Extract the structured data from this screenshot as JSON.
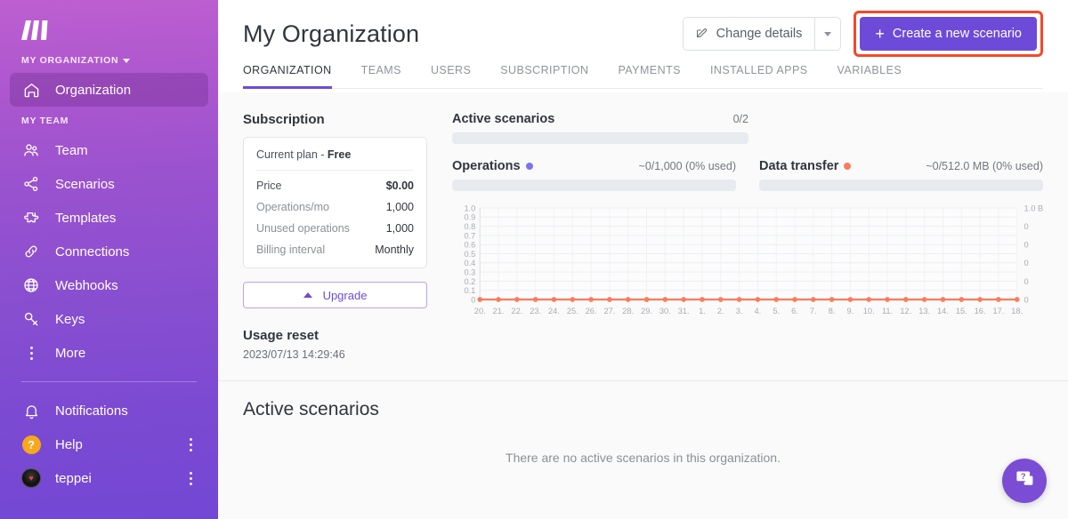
{
  "sidebar": {
    "logo_name": "make-logo",
    "org_group_label": "MY ORGANIZATION",
    "team_group_label": "MY TEAM",
    "org_items": [
      {
        "label": "Organization",
        "icon": "home-icon",
        "active": true
      }
    ],
    "team_items": [
      {
        "label": "Team",
        "icon": "team-icon"
      },
      {
        "label": "Scenarios",
        "icon": "scenarios-icon"
      },
      {
        "label": "Templates",
        "icon": "templates-icon"
      },
      {
        "label": "Connections",
        "icon": "connections-icon"
      },
      {
        "label": "Webhooks",
        "icon": "webhooks-icon"
      },
      {
        "label": "Keys",
        "icon": "keys-icon"
      },
      {
        "label": "More",
        "icon": "more-icon"
      }
    ],
    "bottom_items": [
      {
        "label": "Notifications",
        "icon": "bell-icon"
      },
      {
        "label": "Help",
        "icon": "help-icon"
      },
      {
        "label": "teppei",
        "icon": "avatar-icon"
      }
    ]
  },
  "header": {
    "title": "My Organization",
    "change_details_label": "Change details",
    "change_details_icon": "edit-icon",
    "create_scenario_label": "Create a new scenario",
    "highlight_color": "#f4472b",
    "primary_color": "#6d4bd8"
  },
  "tabs": [
    {
      "label": "ORGANIZATION",
      "active": true
    },
    {
      "label": "TEAMS",
      "active": false
    },
    {
      "label": "USERS",
      "active": false
    },
    {
      "label": "SUBSCRIPTION",
      "active": false
    },
    {
      "label": "PAYMENTS",
      "active": false
    },
    {
      "label": "INSTALLED APPS",
      "active": false
    },
    {
      "label": "VARIABLES",
      "active": false
    }
  ],
  "subscription": {
    "section_title": "Subscription",
    "current_plan_prefix": "Current plan - ",
    "current_plan_name": "Free",
    "rows": [
      {
        "key": "Price",
        "value": "$0.00"
      },
      {
        "key": "Operations/mo",
        "value": "1,000"
      },
      {
        "key": "Unused operations",
        "value": "1,000"
      },
      {
        "key": "Billing interval",
        "value": "Monthly"
      }
    ],
    "upgrade_label": "Upgrade",
    "usage_reset_title": "Usage reset",
    "usage_reset_value": "2023/07/13 14:29:46"
  },
  "meters": {
    "active_scenarios": {
      "name": "Active scenarios",
      "value": "0/2",
      "progress_pct": 0
    },
    "operations": {
      "name": "Operations",
      "value": "~0/1,000 (0% used)",
      "dot_color": "#7b74f0",
      "progress_pct": 0
    },
    "data_transfer": {
      "name": "Data transfer",
      "value": "~0/512.0 MB (0% used)",
      "dot_color": "#f97c5c",
      "progress_pct": 0
    }
  },
  "chart_data": {
    "type": "line",
    "title": "",
    "xlabel": "",
    "ylabel": "",
    "grid": true,
    "legend": "none",
    "x": [
      "20.",
      "21.",
      "22.",
      "23.",
      "24.",
      "25.",
      "26.",
      "27.",
      "28.",
      "29.",
      "30.",
      "31.",
      "1.",
      "2.",
      "3.",
      "4.",
      "5.",
      "6.",
      "7.",
      "8.",
      "9.",
      "10.",
      "11.",
      "12.",
      "13.",
      "14.",
      "15.",
      "16.",
      "17.",
      "18."
    ],
    "left_axis": {
      "label": "",
      "ticks": [
        "1.0",
        "0.9",
        "0.8",
        "0.7",
        "0.6",
        "0.5",
        "0.4",
        "0.3",
        "0.2",
        "0.1",
        "0"
      ],
      "ylim": [
        0,
        1
      ]
    },
    "right_axis": {
      "label": "",
      "ticks": [
        "1.0 B",
        "0",
        "0",
        "0",
        "0",
        "0"
      ],
      "ylim": [
        0,
        1
      ]
    },
    "series": [
      {
        "name": "Operations",
        "color": "#f97c5c",
        "values": [
          0,
          0,
          0,
          0,
          0,
          0,
          0,
          0,
          0,
          0,
          0,
          0,
          0,
          0,
          0,
          0,
          0,
          0,
          0,
          0,
          0,
          0,
          0,
          0,
          0,
          0,
          0,
          0,
          0,
          0
        ]
      }
    ]
  },
  "active_scenarios_section": {
    "title": "Active scenarios",
    "empty_message": "There are no active scenarios in this organization."
  },
  "fab": {
    "icon": "help-chat-icon",
    "color": "#7b4dd4"
  }
}
